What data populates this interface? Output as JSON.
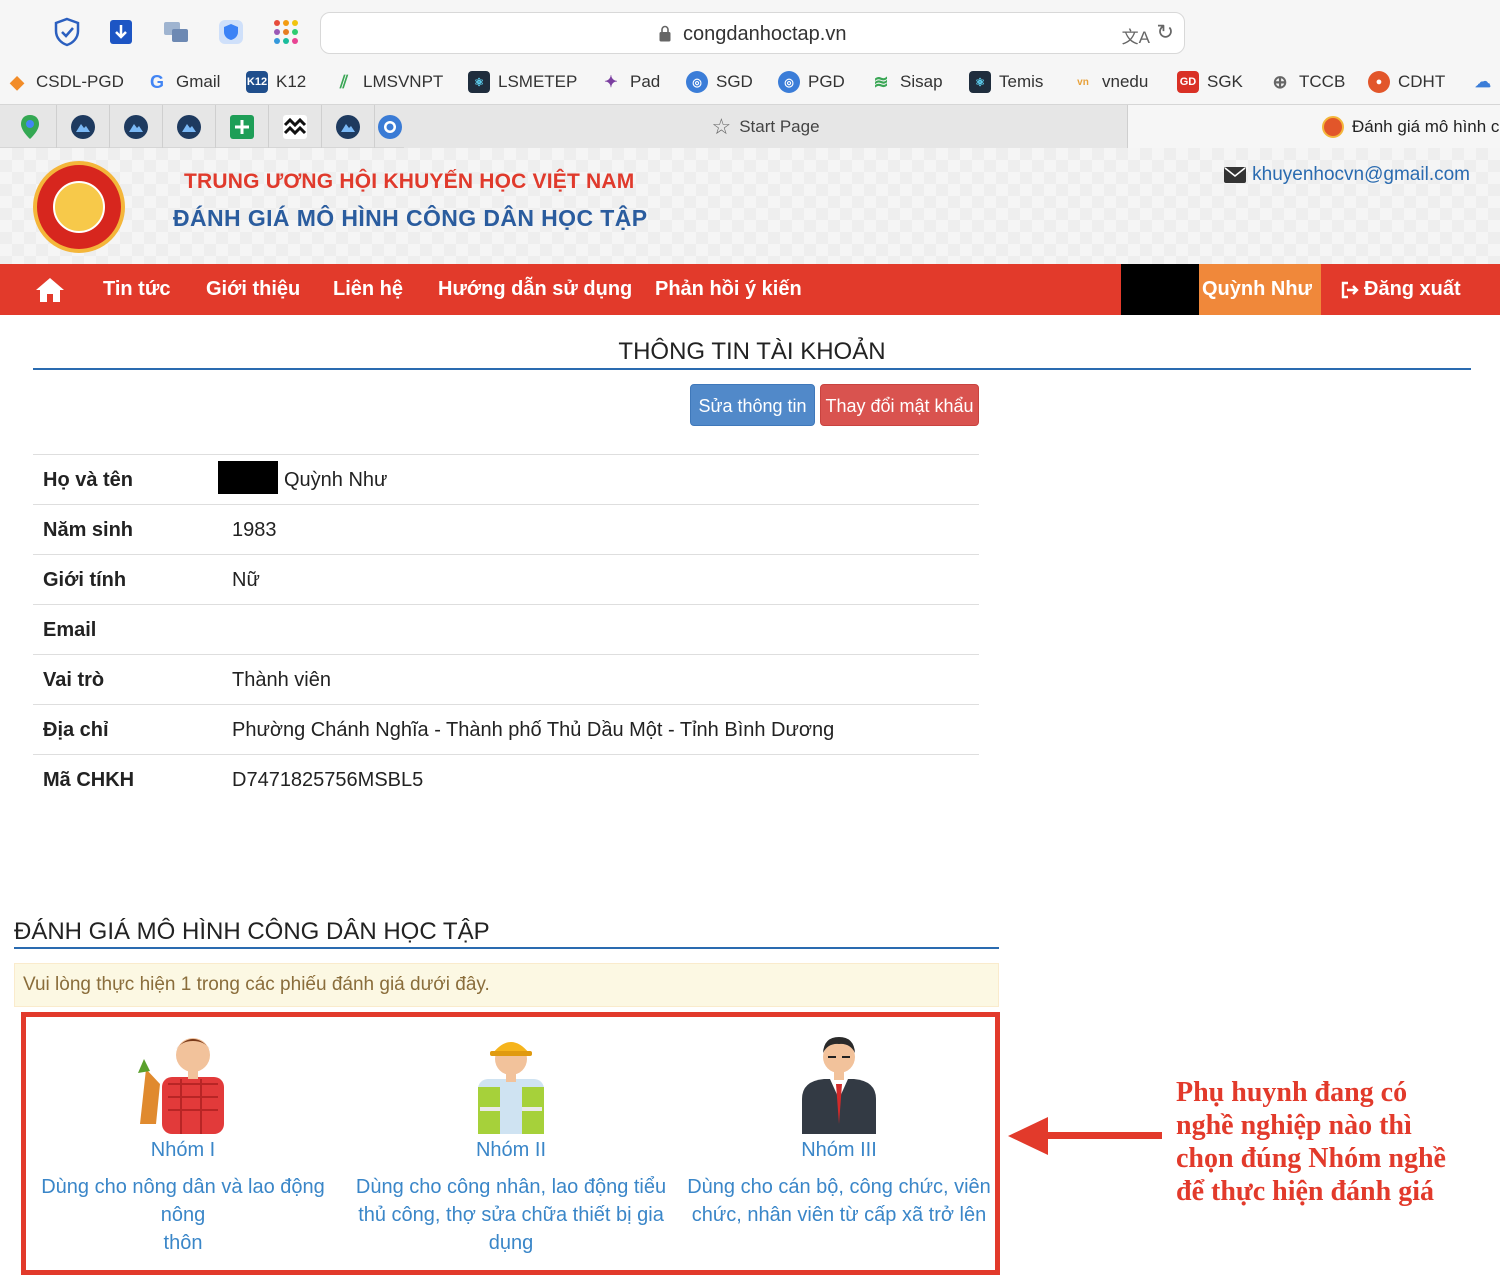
{
  "browser": {
    "url": "congdanhoctap.vn",
    "extensions": [
      "shield-check-icon",
      "bookmark-down-icon",
      "windows-icon",
      "shield-icon",
      "app-grid-icon"
    ],
    "bookmarks": [
      {
        "label": "CSDL-PGD",
        "icon": "diamond-icon",
        "color": "#f28c28"
      },
      {
        "label": "Gmail",
        "icon": "google-icon",
        "color": "#4285f4"
      },
      {
        "label": "K12",
        "icon": "k12-icon",
        "color": "#1f4e8c"
      },
      {
        "label": "LMSVNPT",
        "icon": "lms-icon",
        "color": "#3aa655"
      },
      {
        "label": "LSMETEP",
        "icon": "react-icon",
        "color": "#1f2d3d"
      },
      {
        "label": "Pad",
        "icon": "bird-icon",
        "color": "#7b3fa0"
      },
      {
        "label": "SGD",
        "icon": "globe-icon",
        "color": "#3b7dd8"
      },
      {
        "label": "PGD",
        "icon": "globe-icon",
        "color": "#3b7dd8"
      },
      {
        "label": "Sisap",
        "icon": "sisap-icon",
        "color": "#3aa655"
      },
      {
        "label": "Temis",
        "icon": "react-icon",
        "color": "#1f2d3d"
      },
      {
        "label": "vnedu",
        "icon": "vnedu-icon",
        "color": "#e8a13a"
      },
      {
        "label": "SGK",
        "icon": "sgk-icon",
        "color": "#d93025"
      },
      {
        "label": "TCCB",
        "icon": "globe-icon",
        "color": "#666666"
      },
      {
        "label": "CDHT",
        "icon": "seal-icon",
        "color": "#e2562a"
      }
    ],
    "pinned_tabs": [
      "map-pin-icon",
      "mountain-icon",
      "mountain-icon",
      "mountain-icon",
      "sheets-icon",
      "waves-icon",
      "mountain-icon",
      "chrome-icon"
    ],
    "start_tab": "Start Page",
    "active_tab": "Đánh giá mô hình c"
  },
  "header": {
    "org_line1": "TRUNG ƯƠNG HỘI KHUYẾN HỌC VIỆT NAM",
    "org_line2": "ĐÁNH GIÁ MÔ HÌNH CÔNG DÂN HỌC TẬP",
    "email": "khuyenhocvn@gmail.com"
  },
  "nav": {
    "items": [
      "Tin tức",
      "Giới thiệu",
      "Liên hệ",
      "Hướng dẫn sử dụng",
      "Phản hồi ý kiến"
    ],
    "user": "Quỳnh Như",
    "logout": "Đăng xuất"
  },
  "account": {
    "title": "THÔNG TIN TÀI KHOẢN",
    "edit_button": "Sửa thông tin",
    "password_button": "Thay đổi mật khẩu",
    "rows": [
      {
        "label": "Họ và tên",
        "value": "Quỳnh Như"
      },
      {
        "label": "Năm sinh",
        "value": "1983"
      },
      {
        "label": "Giới tính",
        "value": "Nữ"
      },
      {
        "label": "Email",
        "value": ""
      },
      {
        "label": "Vai trò",
        "value": "Thành viên"
      },
      {
        "label": "Địa chỉ",
        "value": "Phường Chánh Nghĩa - Thành phố Thủ Dầu Một - Tỉnh Bình Dương"
      },
      {
        "label": "Mã CHKH",
        "value": "D7471825756MSBL5"
      }
    ]
  },
  "evaluation": {
    "title": "ĐÁNH GIÁ MÔ HÌNH CÔNG DÂN HỌC TẬP",
    "notice": "Vui lòng thực hiện 1 trong các phiếu đánh giá dưới đây.",
    "groups": [
      {
        "name": "Nhóm I",
        "line1": "Dùng cho nông dân và lao động nông",
        "line2": "thôn",
        "line3": ""
      },
      {
        "name": "Nhóm II",
        "line1": "Dùng cho công nhân, lao động tiểu",
        "line2": "thủ công, thợ sửa chữa thiết bị gia",
        "line3": "dụng"
      },
      {
        "name": "Nhóm III",
        "line1": "Dùng cho cán bộ, công chức, viên",
        "line2": "chức, nhân viên từ cấp xã trở lên",
        "line3": ""
      }
    ],
    "callout": [
      "Phụ huynh đang có",
      "nghề nghiệp nào thì",
      "chọn đúng Nhóm nghề",
      "để thực hiện đánh giá"
    ]
  },
  "colors": {
    "nav_red": "#e23a2b",
    "user_orange": "#f0883a",
    "link_blue": "#3a86c8",
    "title_blue": "#2a5c9e"
  }
}
